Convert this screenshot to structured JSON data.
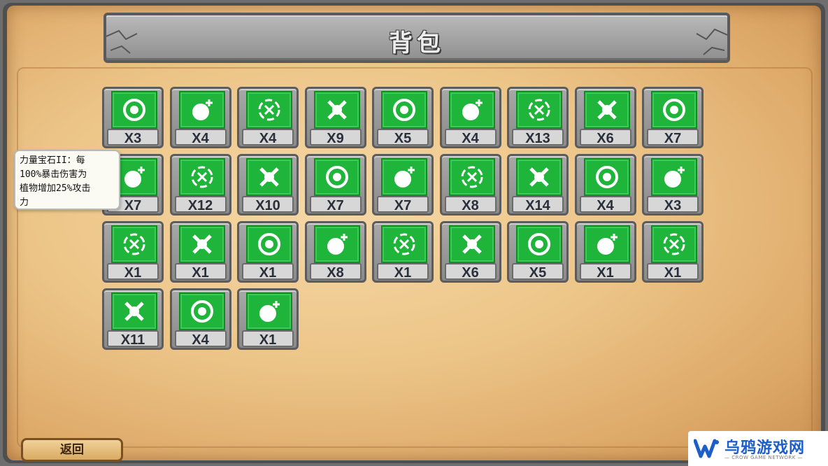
{
  "title": "背包",
  "tooltip": {
    "lines": [
      "力量宝石II：每",
      "100%暴击伤害为",
      "植物增加25%攻击",
      "力"
    ]
  },
  "back_button": "返回",
  "watermark": {
    "title": "乌鸦游戏网",
    "subtitle": "— CROW GAME NETWORK —"
  },
  "items": [
    {
      "icon": "peashooter-gem-icon",
      "count": "X3"
    },
    {
      "icon": "seed-plus-gem-icon",
      "count": "X4"
    },
    {
      "icon": "crosshair-gem-icon",
      "count": "X4"
    },
    {
      "icon": "cross-target-gem-icon",
      "count": "X9"
    },
    {
      "icon": "peashooter-ring-gem-icon",
      "count": "X5"
    },
    {
      "icon": "wallnut-face-gem-icon",
      "count": "X4"
    },
    {
      "icon": "potato-face-gem-icon",
      "count": "X13"
    },
    {
      "icon": "hand-minus-gem-icon",
      "count": "X6"
    },
    {
      "icon": "card-plus-gem-icon",
      "count": "X7"
    },
    {
      "icon": "sun-minus-gem-icon",
      "count": "X7"
    },
    {
      "icon": "sun-plus-gem-icon",
      "count": "X12"
    },
    {
      "icon": "bomb-plus-gem-icon",
      "count": "X10"
    },
    {
      "icon": "spiky-plus-gem-icon",
      "count": "X7"
    },
    {
      "icon": "cactus-plus-gem-icon",
      "count": "X7"
    },
    {
      "icon": "cherry-plus-gem-icon",
      "count": "X8"
    },
    {
      "icon": "heart-shield-gem-icon",
      "count": "X14"
    },
    {
      "icon": "clover-ring-gem-icon",
      "count": "X4"
    },
    {
      "icon": "chomper-mouth-gem-icon",
      "count": "X3"
    },
    {
      "icon": "chomper-ring-gem-icon",
      "count": "X1"
    },
    {
      "icon": "plus-circle-gem-icon",
      "count": "X1"
    },
    {
      "icon": "zero-circle-gem-icon",
      "count": "X1"
    },
    {
      "icon": "hammer-minus-gem-icon",
      "count": "X8"
    },
    {
      "icon": "drop-circle-gem-icon",
      "count": "X1"
    },
    {
      "icon": "fire-mouth-gem-icon",
      "count": "X6"
    },
    {
      "icon": "twin-seed-plus-gem-icon",
      "count": "X5"
    },
    {
      "icon": "plus-circle-ring-gem-icon",
      "count": "X1"
    },
    {
      "icon": "chomper-fire-gem-icon",
      "count": "X1"
    },
    {
      "icon": "sun-ring-gem-icon",
      "count": "X11"
    },
    {
      "icon": "cherry-bomb-plus-gem-icon",
      "count": "X4"
    },
    {
      "icon": "shovel-plant-gem-icon",
      "count": "X1"
    }
  ]
}
